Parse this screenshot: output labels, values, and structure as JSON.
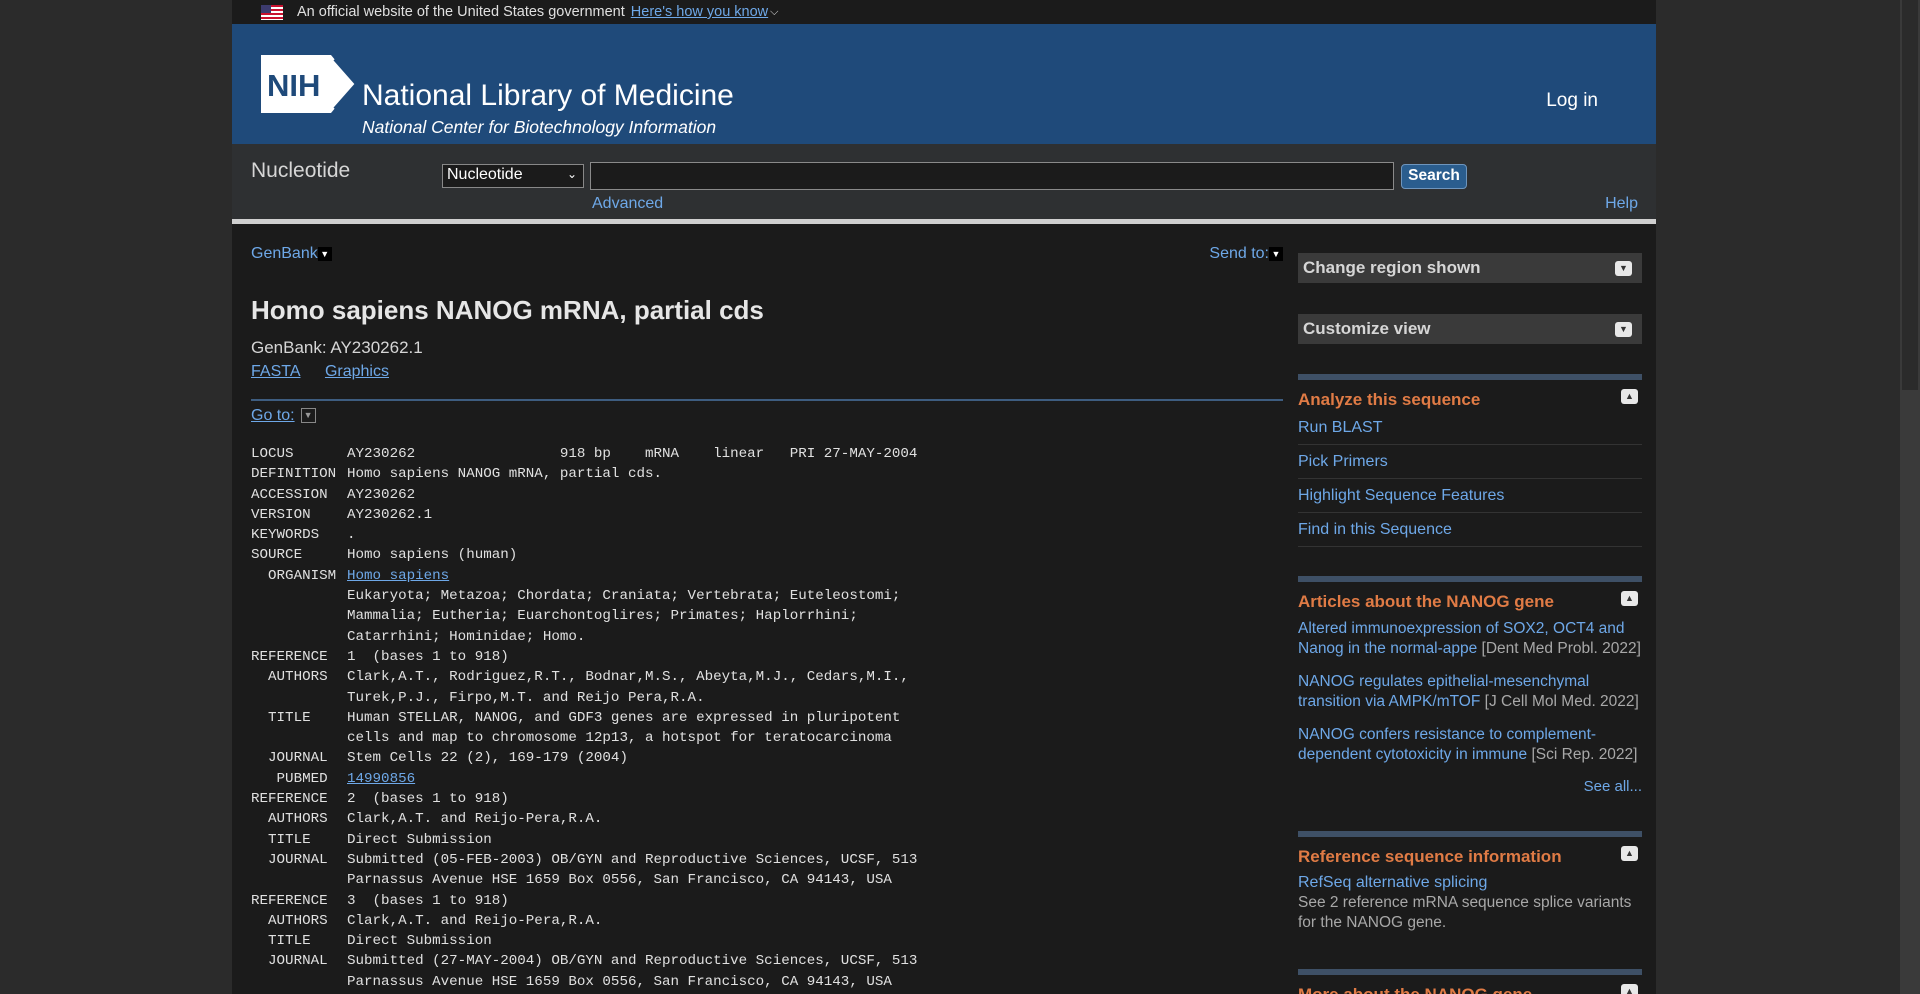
{
  "gov_banner": {
    "text": "An official website of the United States government",
    "link": "Here's how you know"
  },
  "header": {
    "logo_text": "NIH",
    "title": "National Library of Medicine",
    "subtitle": "National Center for Biotechnology Information",
    "login": "Log in"
  },
  "search": {
    "db_name": "Nucleotide",
    "db_selected": "Nucleotide",
    "query": "",
    "button": "Search",
    "advanced": "Advanced",
    "help": "Help"
  },
  "record": {
    "format_menu": "GenBank",
    "send_to": "Send to:",
    "title": "Homo sapiens NANOG mRNA, partial cds",
    "accession_line": "GenBank: AY230262.1",
    "links": [
      "FASTA",
      "Graphics"
    ],
    "goto": "Go to:",
    "flatfile": [
      {
        "key": "LOCUS",
        "val": "AY230262                 918 bp    mRNA    linear   PRI 27-MAY-2004"
      },
      {
        "key": "DEFINITION",
        "val": "Homo sapiens NANOG mRNA, partial cds."
      },
      {
        "key": "ACCESSION",
        "val": "AY230262"
      },
      {
        "key": "VERSION",
        "val": "AY230262.1"
      },
      {
        "key": "KEYWORDS",
        "val": "."
      },
      {
        "key": "SOURCE",
        "val": "Homo sapiens (human)"
      },
      {
        "key": "  ORGANISM",
        "val": "Homo sapiens",
        "link": true
      },
      {
        "key": "",
        "val": "Eukaryota; Metazoa; Chordata; Craniata; Vertebrata; Euteleostomi;"
      },
      {
        "key": "",
        "val": "Mammalia; Eutheria; Euarchontoglires; Primates; Haplorrhini;"
      },
      {
        "key": "",
        "val": "Catarrhini; Hominidae; Homo."
      },
      {
        "key": "REFERENCE",
        "val": "1  (bases 1 to 918)"
      },
      {
        "key": "  AUTHORS",
        "val": "Clark,A.T., Rodriguez,R.T., Bodnar,M.S., Abeyta,M.J., Cedars,M.I.,"
      },
      {
        "key": "",
        "val": "Turek,P.J., Firpo,M.T. and Reijo Pera,R.A."
      },
      {
        "key": "  TITLE",
        "val": "Human STELLAR, NANOG, and GDF3 genes are expressed in pluripotent"
      },
      {
        "key": "",
        "val": "cells and map to chromosome 12p13, a hotspot for teratocarcinoma"
      },
      {
        "key": "  JOURNAL",
        "val": "Stem Cells 22 (2), 169-179 (2004)"
      },
      {
        "key": "   PUBMED",
        "val": "14990856",
        "link": true
      },
      {
        "key": "REFERENCE",
        "val": "2  (bases 1 to 918)"
      },
      {
        "key": "  AUTHORS",
        "val": "Clark,A.T. and Reijo-Pera,R.A."
      },
      {
        "key": "  TITLE",
        "val": "Direct Submission"
      },
      {
        "key": "  JOURNAL",
        "val": "Submitted (05-FEB-2003) OB/GYN and Reproductive Sciences, UCSF, 513"
      },
      {
        "key": "",
        "val": "Parnassus Avenue HSE 1659 Box 0556, San Francisco, CA 94143, USA"
      },
      {
        "key": "REFERENCE",
        "val": "3  (bases 1 to 918)"
      },
      {
        "key": "  AUTHORS",
        "val": "Clark,A.T. and Reijo-Pera,R.A."
      },
      {
        "key": "  TITLE",
        "val": "Direct Submission"
      },
      {
        "key": "  JOURNAL",
        "val": "Submitted (27-MAY-2004) OB/GYN and Reproductive Sciences, UCSF, 513"
      },
      {
        "key": "",
        "val": "Parnassus Avenue HSE 1659 Box 0556, San Francisco, CA 94143, USA"
      }
    ]
  },
  "sidebar": {
    "change_region": "Change region shown",
    "customize_view": "Customize view",
    "analyze": {
      "title": "Analyze this sequence",
      "links": [
        "Run BLAST",
        "Pick Primers",
        "Highlight Sequence Features",
        "Find in this Sequence"
      ]
    },
    "articles": {
      "title": "Articles about the NANOG gene",
      "items": [
        {
          "title": "Altered immunoexpression of SOX2, OCT4 and Nanog in the normal-appe",
          "cite": "[Dent Med Probl. 2022]"
        },
        {
          "title": "NANOG regulates epithelial-mesenchymal transition via AMPK/mTOF",
          "cite": "[J Cell Mol Med. 2022]"
        },
        {
          "title": "NANOG confers resistance to complement-dependent cytotoxicity in immune",
          "cite": "[Sci Rep. 2022]"
        }
      ],
      "see_all": "See all..."
    },
    "refseq": {
      "title": "Reference sequence information",
      "link": "RefSeq alternative splicing",
      "desc": "See 2 reference mRNA sequence splice variants for the NANOG gene."
    },
    "more": {
      "title": "More about the NANOG gene"
    }
  }
}
